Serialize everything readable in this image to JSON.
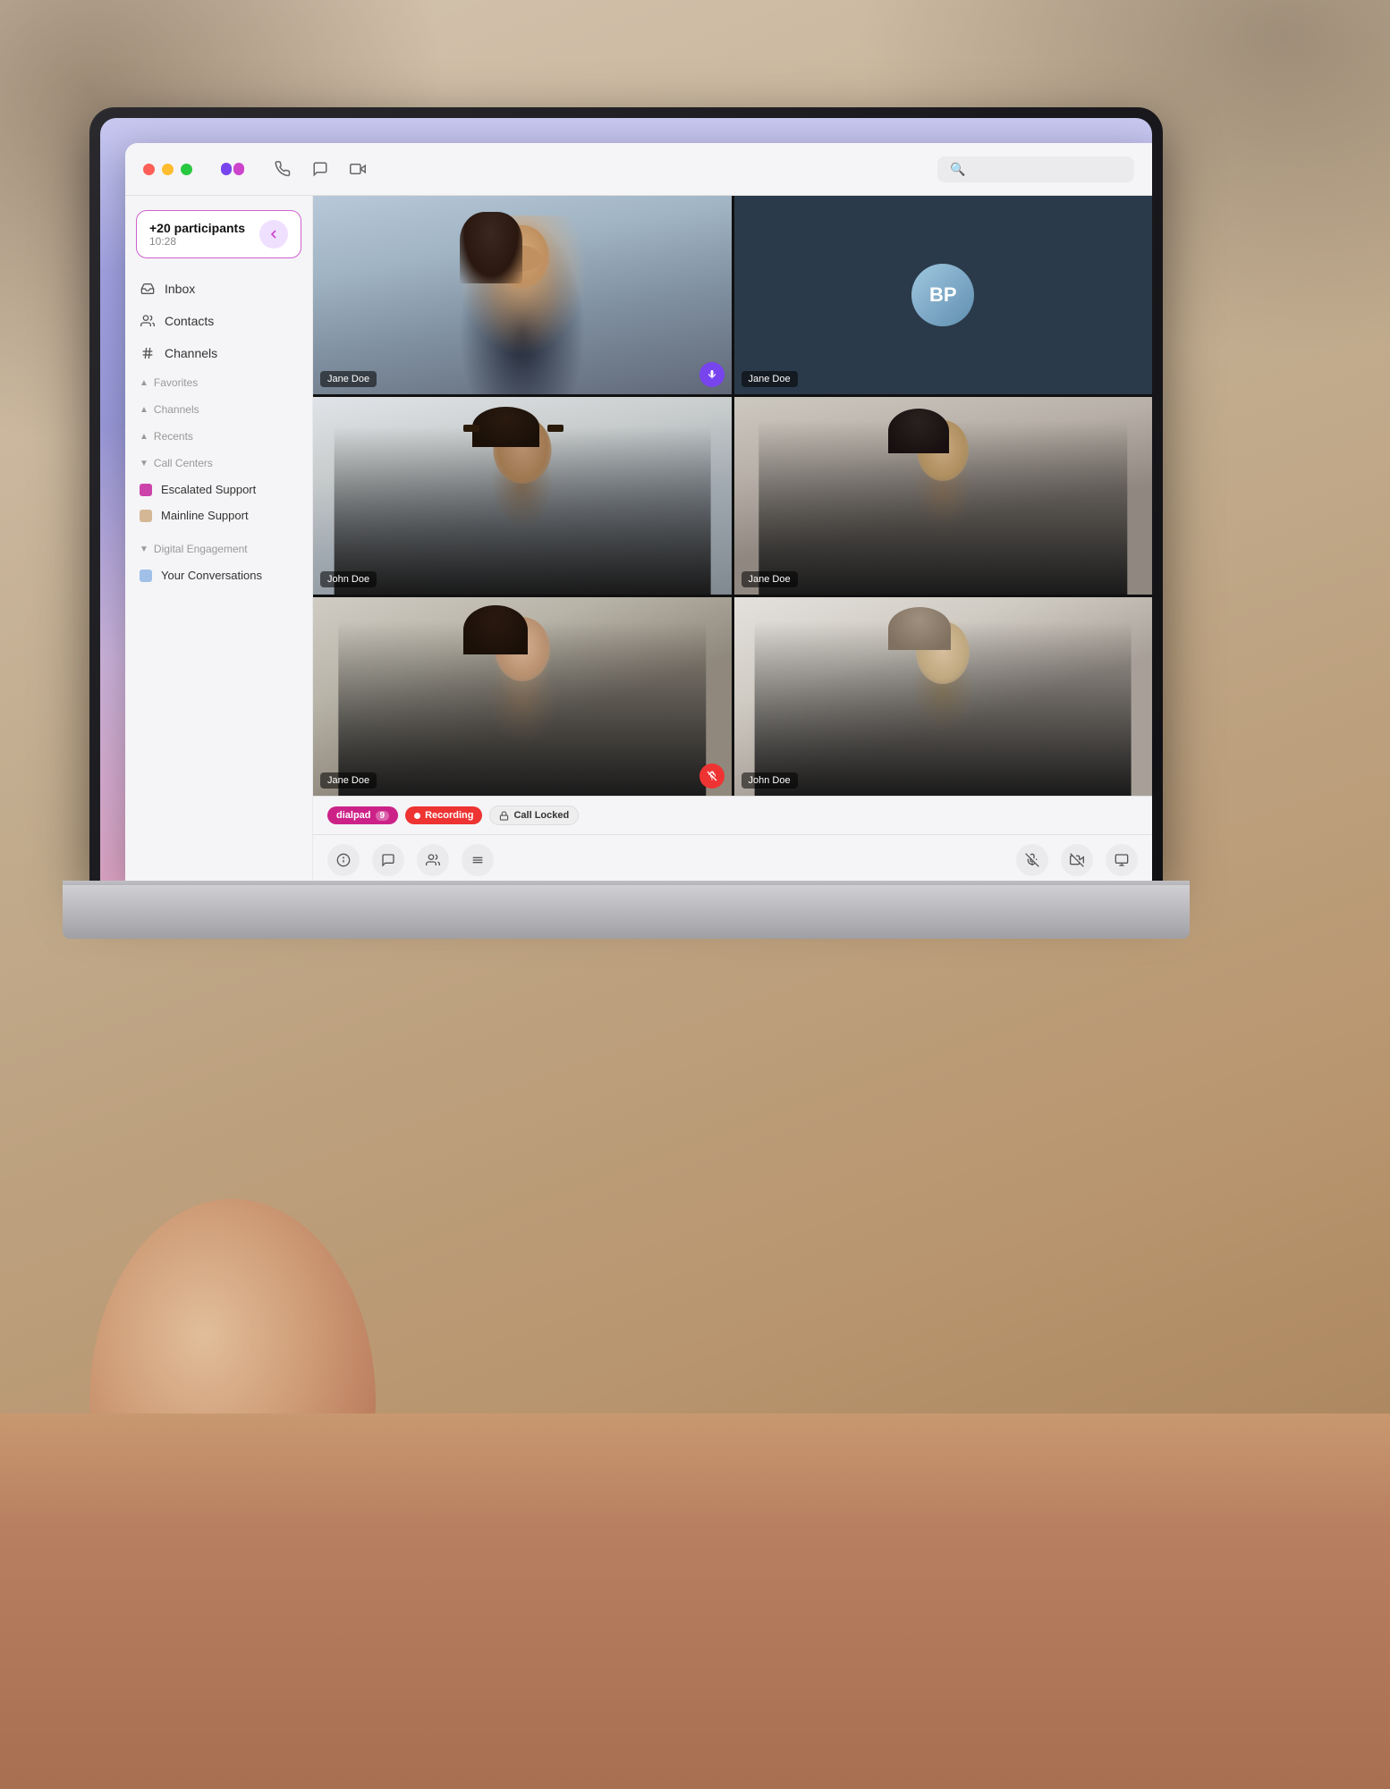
{
  "window": {
    "title": "Dialpad",
    "controls": [
      "close",
      "minimize",
      "maximize"
    ]
  },
  "titlebar": {
    "search_placeholder": "Search",
    "icons": [
      "phone",
      "chat",
      "video"
    ]
  },
  "sidebar": {
    "call": {
      "participants": "+20 participants",
      "time": "10:28"
    },
    "nav_items": [
      {
        "id": "inbox",
        "label": "Inbox",
        "icon": "inbox"
      },
      {
        "id": "contacts",
        "label": "Contacts",
        "icon": "contacts"
      },
      {
        "id": "channels",
        "label": "Channels",
        "icon": "hash"
      }
    ],
    "sections": [
      {
        "id": "favorites",
        "label": "Favorites",
        "collapsed": false
      },
      {
        "id": "channels",
        "label": "Channels",
        "collapsed": false
      },
      {
        "id": "recents",
        "label": "Recents",
        "collapsed": false
      },
      {
        "id": "call-centers",
        "label": "Call Centers",
        "collapsed": true
      }
    ],
    "call_centers": [
      {
        "id": "escalated",
        "label": "Escalated Support",
        "color": "#cc44aa"
      },
      {
        "id": "mainline",
        "label": "Mainline Support",
        "color": "#d4b896"
      }
    ],
    "digital_engagement": {
      "label": "Digital Engagement",
      "items": [
        {
          "id": "your-conversations",
          "label": "Your Conversations",
          "color": "#a0c0e8"
        }
      ]
    }
  },
  "video": {
    "participants": [
      {
        "id": 1,
        "name": "Jane Doe",
        "active": true,
        "audio": true,
        "muted": false,
        "avatar_type": "video"
      },
      {
        "id": 2,
        "name": "Jane Doe",
        "active": false,
        "audio": false,
        "muted": false,
        "avatar_type": "initials",
        "initials": "BP"
      },
      {
        "id": 3,
        "name": "John Doe",
        "active": false,
        "audio": false,
        "muted": false,
        "avatar_type": "video"
      },
      {
        "id": 4,
        "name": "Jane Doe",
        "active": false,
        "audio": false,
        "muted": false,
        "avatar_type": "video"
      },
      {
        "id": 5,
        "name": "Jane Doe",
        "active": false,
        "audio": false,
        "muted": true,
        "avatar_type": "video"
      },
      {
        "id": 6,
        "name": "John Doe",
        "active": false,
        "audio": false,
        "muted": false,
        "avatar_type": "video"
      }
    ]
  },
  "status_badges": [
    {
      "id": "dialpad",
      "label": "dialpad",
      "type": "dialpad",
      "count": "9"
    },
    {
      "id": "recording",
      "label": "Recording",
      "type": "recording"
    },
    {
      "id": "call-locked",
      "label": "Call Locked",
      "type": "locked"
    }
  ],
  "bottom_controls": {
    "left": [
      "info",
      "chat",
      "participants",
      "settings"
    ],
    "right": [
      "mute",
      "video-off",
      "screen-share"
    ]
  }
}
